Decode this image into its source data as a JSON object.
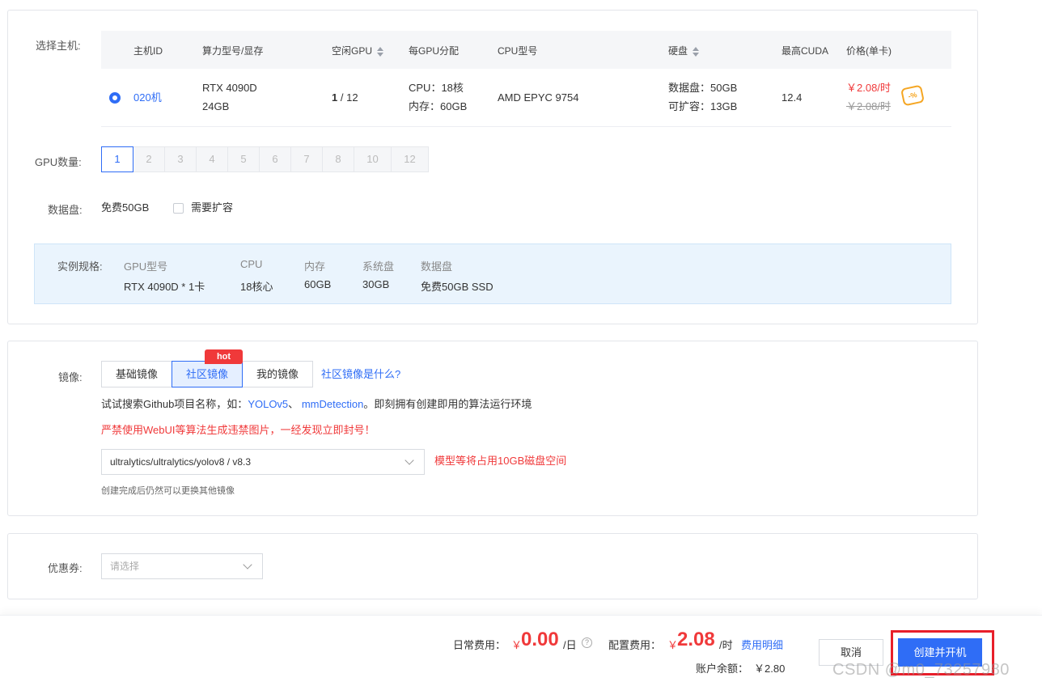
{
  "host_section": {
    "label": "选择主机:",
    "columns": {
      "host_id": "主机ID",
      "gpu_model": "算力型号/显存",
      "idle_gpu": "空闲GPU",
      "per_gpu": "每GPU分配",
      "cpu_model": "CPU型号",
      "disk": "硬盘",
      "max_cuda": "最高CUDA",
      "price": "价格(单卡)"
    },
    "row": {
      "host_id": "020机",
      "gpu_model": "RTX 4090D",
      "gpu_mem": "24GB",
      "idle_gpu_free": "1",
      "idle_gpu_total": "/ 12",
      "per_gpu_cpu": "CPU：18核",
      "per_gpu_mem": "内存：60GB",
      "cpu_model": "AMD EPYC 9754",
      "disk_data": "数据盘：50GB",
      "disk_expand": "可扩容：13GB",
      "max_cuda": "12.4",
      "price_current": "￥2.08/时",
      "price_original": "￥2.08/时",
      "coupon_icon_text": "-%",
      "selected": true
    }
  },
  "gpu_count": {
    "label": "GPU数量:",
    "options": [
      "1",
      "2",
      "3",
      "4",
      "5",
      "6",
      "7",
      "8",
      "10",
      "12"
    ],
    "selected": "1"
  },
  "data_disk": {
    "label": "数据盘:",
    "free": "免费50GB",
    "expand_label": "需要扩容",
    "expand_checked": false
  },
  "spec": {
    "label": "实例规格:",
    "gpu_key": "GPU型号",
    "gpu_val": "RTX 4090D * 1卡",
    "cpu_key": "CPU",
    "cpu_val": "18核心",
    "mem_key": "内存",
    "mem_val": "60GB",
    "sys_key": "系统盘",
    "sys_val": "30GB",
    "data_key": "数据盘",
    "data_val": "免费50GB SSD"
  },
  "image_section": {
    "label": "镜像:",
    "tabs": [
      "基础镜像",
      "社区镜像",
      "我的镜像"
    ],
    "active_tab": "社区镜像",
    "hot_badge": "hot",
    "what_link": "社区镜像是什么?",
    "hint_prefix": "试试搜索Github项目名称，如：",
    "hint_link1": "YOLOv5",
    "hint_sep": "、",
    "hint_link2": "mmDetection",
    "hint_suffix": "。即刻拥有创建即用的算法运行环境",
    "warning": "严禁使用WebUI等算法生成违禁图片，一经发现立即封号！",
    "selected_image": "ultralytics/ultralytics/yolov8 / v8.3",
    "size_note": "模型等将占用10GB磁盘空间",
    "change_note": "创建完成后仍然可以更换其他镜像"
  },
  "coupon": {
    "label": "优惠券:",
    "placeholder": "请选择"
  },
  "footer": {
    "daily_label": "日常费用：",
    "daily_currency": "￥",
    "daily_amount": "0.00",
    "daily_unit": "/日",
    "config_label": "配置费用：",
    "config_currency": "￥",
    "config_amount": "2.08",
    "config_unit": "/时",
    "fee_detail": "费用明细",
    "balance_label": "账户余额：",
    "balance_value": "￥2.80",
    "cancel": "取消",
    "create": "创建并开机",
    "watermark": "CSDN @m0_73257980"
  },
  "colors": {
    "primary": "#2f6df6",
    "danger": "#f0393a",
    "highlight_box": "#e81f2a",
    "spec_bg": "#eaf4fd"
  }
}
